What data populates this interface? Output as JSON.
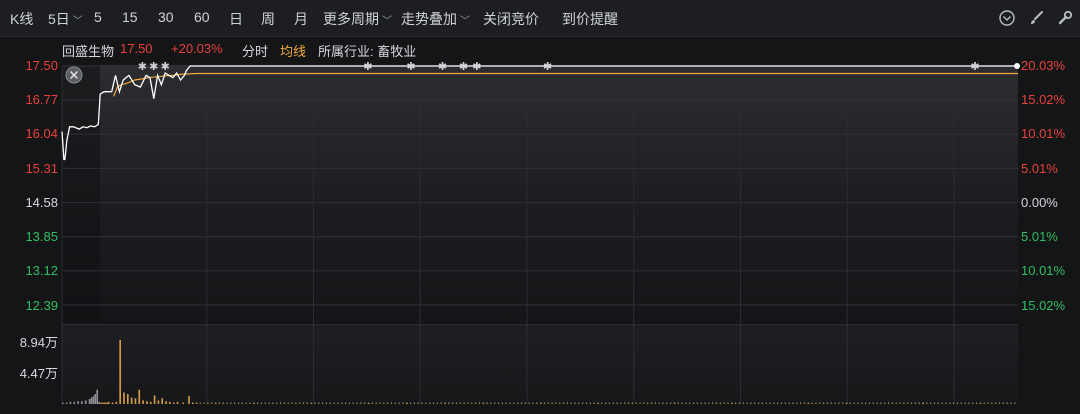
{
  "toolbar": {
    "kline_label": "K线",
    "period_dropdown": "5日",
    "periods": [
      "5",
      "15",
      "30",
      "60",
      "日",
      "周",
      "月"
    ],
    "more_periods": "更多周期",
    "trend_overlay": "走势叠加",
    "close_auction": "关闭竞价",
    "price_alert": "到价提醒",
    "icons": [
      "chevron-circle-icon",
      "brush-icon",
      "wrench-icon"
    ]
  },
  "info": {
    "stock_name": "回盛生物",
    "price": "17.50",
    "change_pct": "+20.03%",
    "timeshare": "分时",
    "avg_line": "均线",
    "industry": "所属行业: 畜牧业"
  },
  "axes": {
    "price_ticks": [
      "17.50",
      "16.77",
      "16.04",
      "15.31",
      "14.58",
      "13.85",
      "13.12",
      "12.39"
    ],
    "pct_ticks": [
      "20.03%",
      "15.02%",
      "10.01%",
      "5.01%",
      "0.00%",
      "5.01%",
      "10.01%",
      "15.02%"
    ],
    "volume_ticks": [
      "8.94万",
      "4.47万"
    ]
  },
  "colors": {
    "up": "#e8413c",
    "down": "#2fbf61",
    "avg_line": "#f2a93b",
    "price_line": "#ffffff",
    "volume": "#d9a04a"
  },
  "chart_data": {
    "type": "line",
    "ylim": [
      12.39,
      17.5
    ],
    "prev_close": 14.58,
    "series": [
      {
        "x": [
          0,
          2,
          3,
          5,
          8,
          12,
          18,
          22,
          26,
          30,
          34,
          38,
          40,
          44,
          47,
          52,
          56,
          60,
          64,
          70,
          76,
          82,
          88,
          92,
          96,
          100,
          104,
          108,
          112,
          116,
          120,
          124,
          128,
          130,
          134,
          1000
        ],
        "values": [
          16.1,
          15.5,
          15.5,
          15.9,
          16.2,
          16.2,
          16.15,
          16.2,
          16.18,
          16.22,
          16.2,
          16.25,
          16.9,
          16.95,
          16.95,
          16.95,
          17.3,
          16.95,
          17.2,
          17.3,
          17.1,
          17.05,
          17.3,
          17.25,
          16.8,
          17.3,
          17.1,
          17.35,
          17.3,
          17.25,
          17.35,
          17.2,
          17.3,
          17.4,
          17.5,
          17.5
        ]
      },
      {
        "name": "均线",
        "x": [
          54,
          58,
          62,
          66,
          70,
          76,
          82,
          88,
          94,
          100,
          108,
          116,
          124,
          130,
          140,
          1000
        ],
        "values": [
          16.85,
          17.05,
          17.1,
          17.12,
          17.15,
          17.2,
          17.22,
          17.24,
          17.26,
          17.27,
          17.29,
          17.3,
          17.32,
          17.33,
          17.34,
          17.34
        ]
      }
    ],
    "volume": {
      "ylim": [
        0,
        8.94
      ],
      "x": [
        0,
        4,
        8,
        12,
        16,
        20,
        24,
        28,
        30,
        32,
        34,
        36,
        38,
        40,
        42,
        44,
        46,
        48,
        52,
        56,
        60,
        64,
        68,
        72,
        76,
        80,
        84,
        88,
        92,
        96,
        100,
        104,
        108,
        112,
        116,
        120,
        126,
        132,
        136,
        140,
        160,
        200,
        260,
        320,
        360,
        400,
        440,
        500,
        560,
        640,
        700,
        780,
        820,
        900,
        960
      ],
      "values": [
        0.2,
        0.2,
        0.3,
        0.3,
        0.4,
        0.4,
        0.5,
        0.7,
        0.9,
        1.1,
        1.4,
        2.0,
        0.3,
        0.2,
        0.2,
        0.2,
        0.2,
        0.3,
        0.2,
        0.3,
        8.94,
        1.6,
        1.4,
        0.9,
        0.8,
        2.0,
        0.5,
        0.4,
        0.3,
        1.2,
        0.5,
        0.8,
        0.4,
        0.3,
        0.2,
        0.3,
        0.2,
        1.1,
        0.2,
        0.2,
        0.1,
        0.1,
        0.1,
        0.15,
        0.15,
        0.1,
        0.15,
        0.2,
        0.1,
        0.15,
        0.1,
        0.15,
        0.1,
        0.2,
        0.1
      ]
    },
    "markers_x": [
      84,
      96,
      108,
      320,
      365,
      398,
      420,
      434,
      508,
      955
    ]
  }
}
